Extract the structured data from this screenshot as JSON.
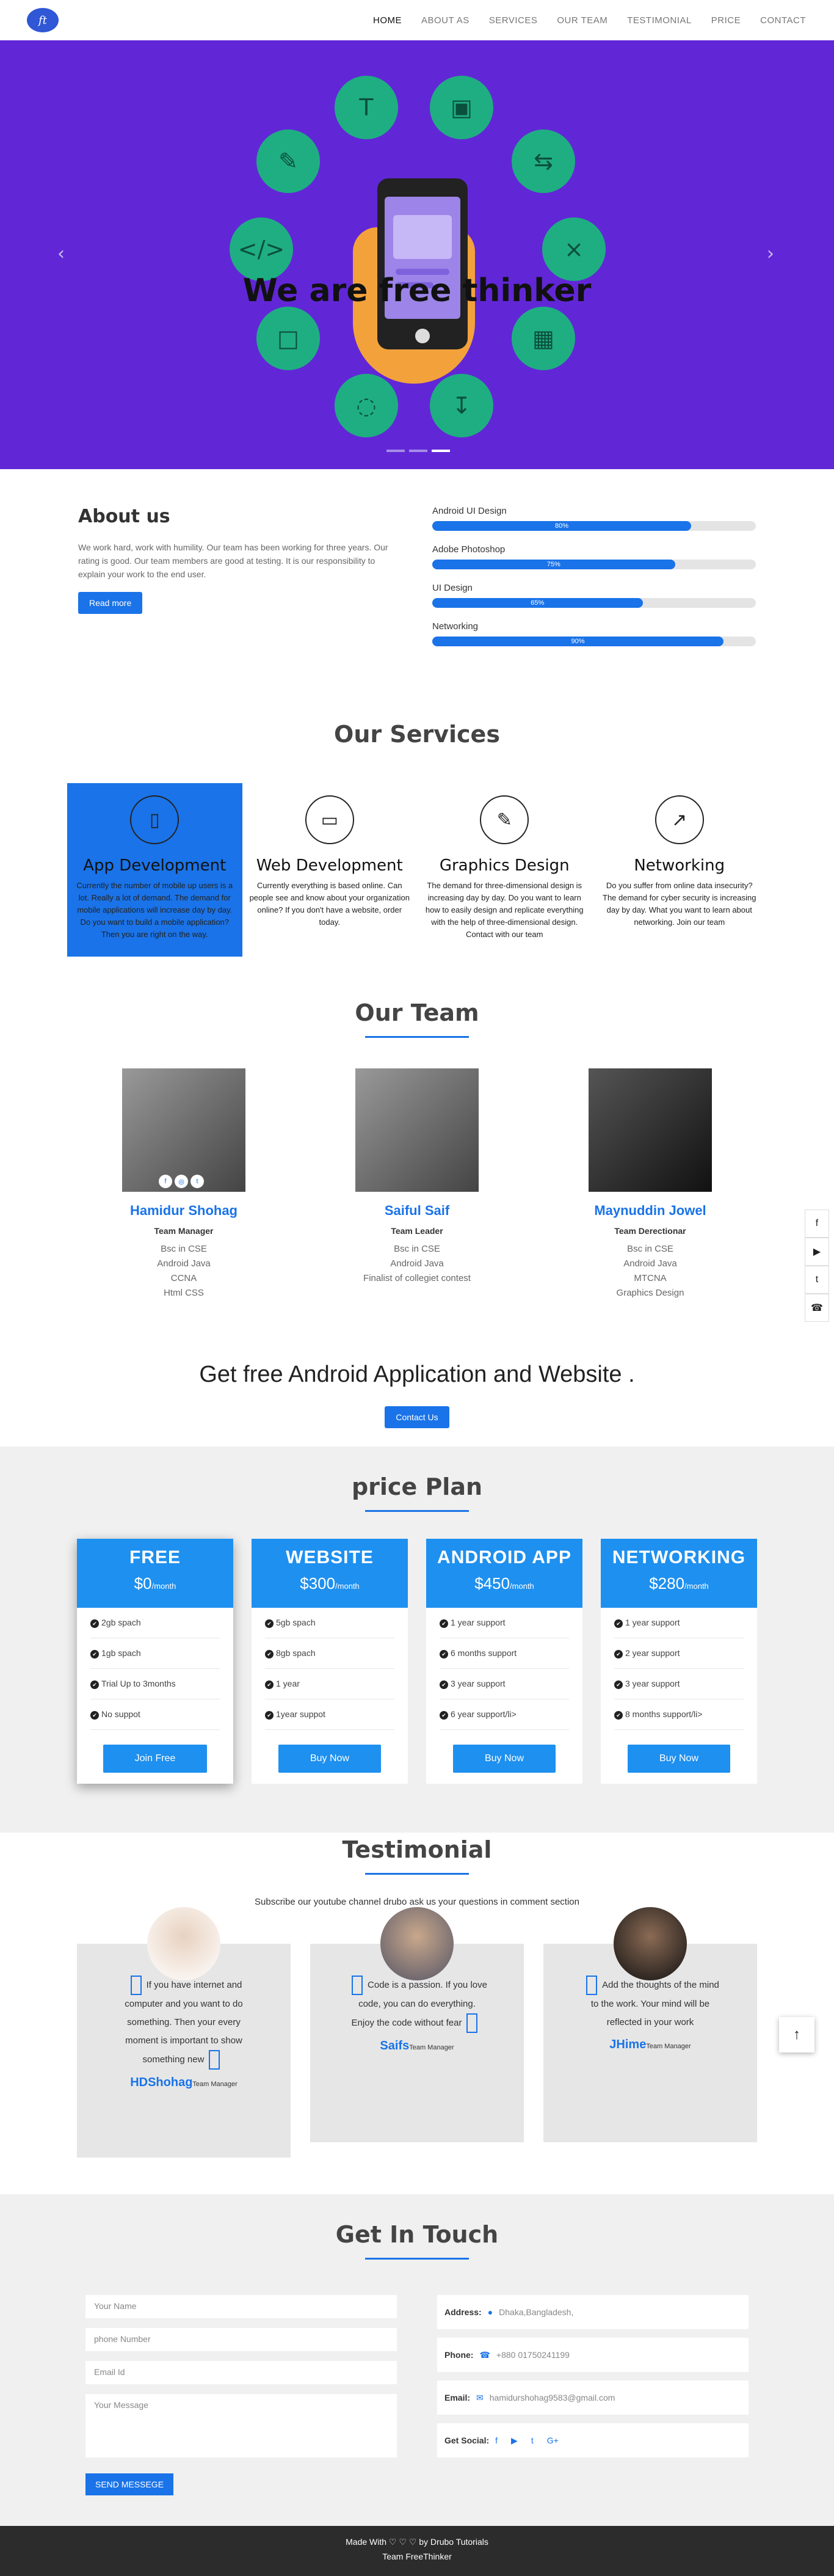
{
  "nav": {
    "logo_text": "ft",
    "items": [
      "HOME",
      "ABOUT AS",
      "SERVICES",
      "OUR TEAM",
      "TESTIMONIAL",
      "PRICE",
      "CONTACT"
    ]
  },
  "hero": {
    "title": "We are free thinker",
    "prev": "‹",
    "next": "›",
    "slide_count": 3,
    "active_slide": 3,
    "colors": {
      "background": "#6127d6",
      "circle": "#1fae82",
      "hand": "#f3a23b"
    }
  },
  "about": {
    "title": "About us",
    "text": "We work hard, work with humility. Our team has been working for three years. Our rating is good. Our team members are good at testing. It is our responsibility to explain your work to the end user.",
    "button": "Read more",
    "skills": [
      {
        "name": "Android UI Design",
        "percent": 80,
        "label": "80%"
      },
      {
        "name": "Adobe Photoshop",
        "percent": 75,
        "label": "75%"
      },
      {
        "name": "UI Design",
        "percent": 65,
        "label": "65%"
      },
      {
        "name": "Networking",
        "percent": 90,
        "label": "90%"
      }
    ]
  },
  "services": {
    "title": "Our Services",
    "items": [
      {
        "icon": "mobile-icon",
        "glyph": "▯",
        "title": "App Development",
        "text": "Currently the number of mobile up users is a lot. Really a lot of demand. The demand for mobile applications will increase day by day. Do you want to build a mobile application? Then you are right on the way."
      },
      {
        "icon": "desktop-icon",
        "glyph": "▭",
        "title": "Web Development",
        "text": "Currently everything is based online. Can people see and know about your organization online? If you don't have a website, order today."
      },
      {
        "icon": "brush-icon",
        "glyph": "✎",
        "title": "Graphics Design",
        "text": "The demand for three-dimensional design is increasing day by day. Do you want to learn how to easily design and replicate everything with the help of three-dimensional design. Contact with our team"
      },
      {
        "icon": "chart-line-icon",
        "glyph": "↗",
        "title": "Networking",
        "text": "Do you suffer from online data insecurity? The demand for cyber security is increasing day by day. What you want to learn about networking. Join our team"
      }
    ]
  },
  "team": {
    "title": "Our Team",
    "members": [
      {
        "name": "Hamidur Shohag",
        "role": "Team Manager",
        "lines": [
          "Bsc in CSE",
          "Android Java",
          "CCNA",
          "Html CSS"
        ]
      },
      {
        "name": "Saiful Saif",
        "role": "Team Leader",
        "lines": [
          "Bsc in CSE",
          "Android Java",
          "Finalist of collegiet contest"
        ]
      },
      {
        "name": "Maynuddin Jowel",
        "role": "Team Derectionar",
        "lines": [
          "Bsc in CSE",
          "Android Java",
          "MTCNA",
          "Graphics Design"
        ]
      }
    ],
    "social": [
      "f",
      "◎",
      "t"
    ]
  },
  "cta": {
    "title": "Get free Android Application and Website .",
    "button": "Contact Us"
  },
  "price": {
    "title": "price Plan",
    "plans": [
      {
        "name": "FREE",
        "amount": "$0",
        "per": "/month",
        "features": [
          "2gb spach",
          "1gb spach",
          "Trial Up to 3months",
          "No suppot"
        ],
        "button": "Join Free"
      },
      {
        "name": "WEBSITE",
        "amount": "$300",
        "per": "/month",
        "features": [
          "5gb spach",
          "8gb spach",
          "1 year",
          "1year suppot"
        ],
        "button": "Buy Now"
      },
      {
        "name": "ANDROID APP",
        "amount": "$450",
        "per": "/month",
        "features": [
          "1 year support",
          "6 months support",
          "3 year support",
          "6 year support/li>"
        ],
        "button": "Buy Now"
      },
      {
        "name": "NETWORKING",
        "amount": "$280",
        "per": "/month",
        "features": [
          "1 year support",
          "2 year support",
          "3 year support",
          "8 months support/li>"
        ],
        "button": "Buy Now"
      }
    ]
  },
  "testimonial": {
    "title": "Testimonial",
    "subtitle": "Subscribe our youtube channel drubo ask us your questions in comment section",
    "items": [
      {
        "text": "If you have internet and computer and you want to do something. Then your every moment is important to show something new",
        "name": "HDShohag",
        "role": "Team Manager"
      },
      {
        "text": "Code is a passion. If you love code, you can do everything. Enjoy the code without fear",
        "name": "Saifs",
        "role": "Team Manager"
      },
      {
        "text": "Add the thoughts of the mind to the work. Your mind will be reflected in your work",
        "name": "JHime",
        "role": "Team Manager"
      }
    ]
  },
  "contact": {
    "title": "Get In Touch",
    "placeholders": {
      "name": "Your Name",
      "phone": "phone Number",
      "email": "Email Id",
      "message": "Your Message"
    },
    "send": "SEND MESSEGE",
    "address_label": "Address:",
    "address": "Dhaka,Bangladesh,",
    "phone_label": "Phone:",
    "phone": "+880 01750241199",
    "email_label": "Email:",
    "email": "hamidurshohag9583@gmail.com",
    "social_label": "Get Social:",
    "social": [
      "f",
      "▶",
      "t",
      "G+"
    ]
  },
  "footer": {
    "line1": "Made With ♡ ♡ ♡ by Drubo Tutorials",
    "line2": "Team FreeThinker"
  },
  "float_social": [
    "f",
    "▶",
    "t",
    "☎"
  ],
  "back_to_top": "↑"
}
